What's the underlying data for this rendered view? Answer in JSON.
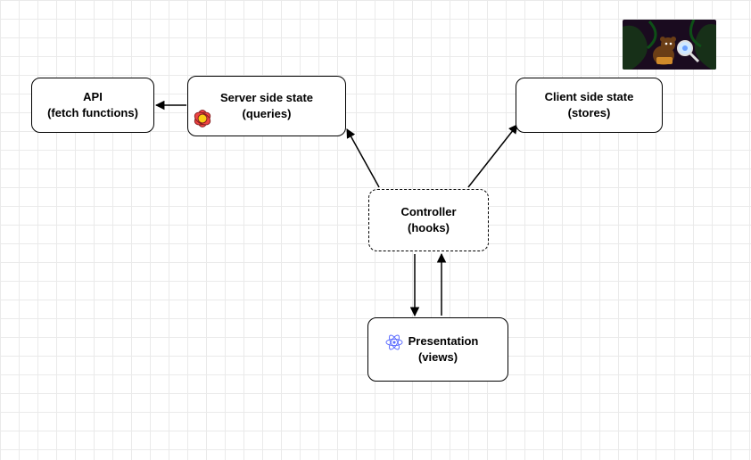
{
  "nodes": {
    "api": {
      "line1": "API",
      "line2": "(fetch functions)"
    },
    "serverState": {
      "line1": "Server side state",
      "line2": "(queries)"
    },
    "clientState": {
      "line1": "Client side state",
      "line2": "(stores)"
    },
    "controller": {
      "line1": "Controller",
      "line2": "(hooks)"
    },
    "presentation": {
      "line1": "Presentation",
      "line2": "(views)"
    }
  },
  "icons": {
    "reactQuery": "react-query-flower-icon",
    "react": "react-atom-icon"
  },
  "thumbnail": {
    "name": "cartoon-thumbnail"
  }
}
